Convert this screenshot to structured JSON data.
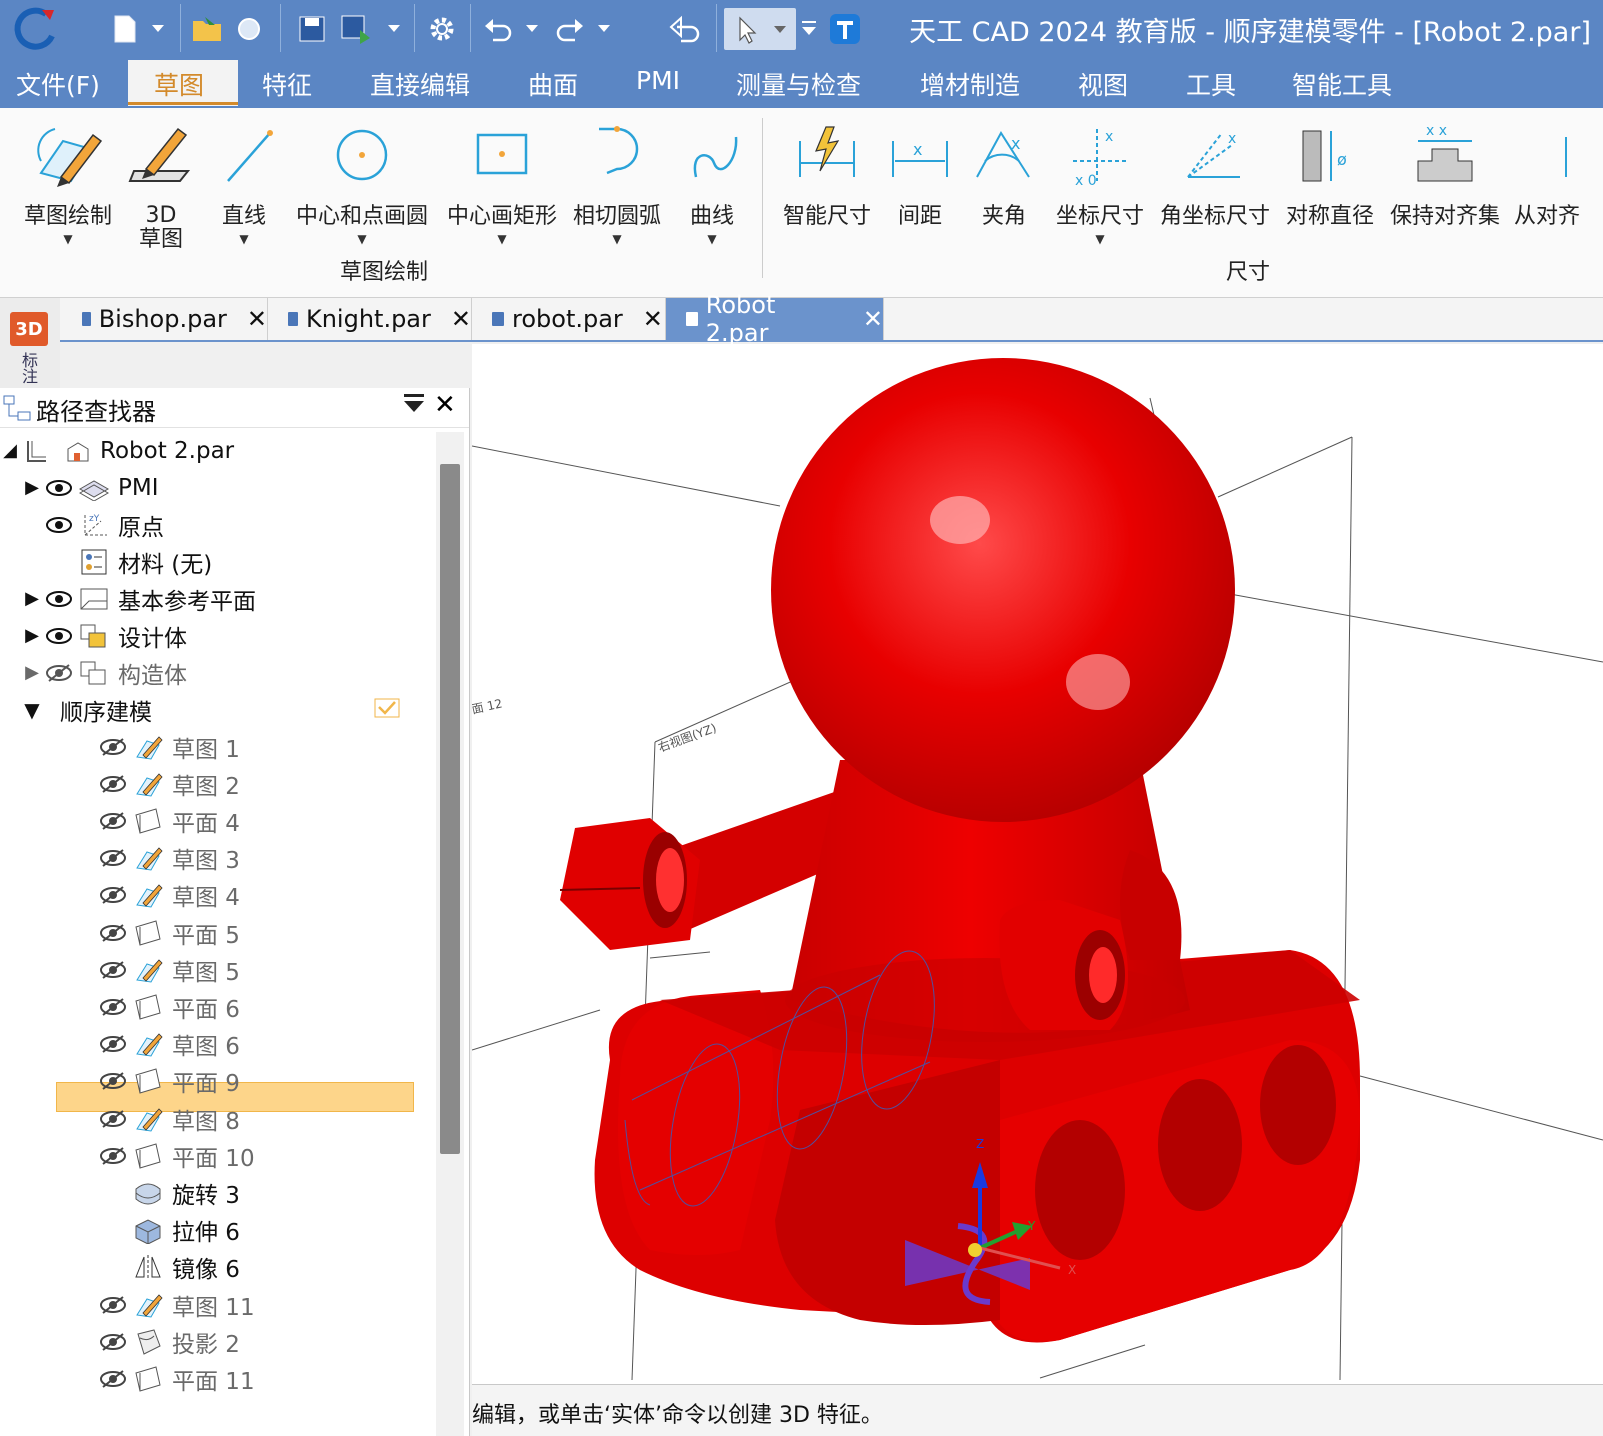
{
  "window": {
    "title": "天工 CAD 2024 教育版 - 顺序建模零件 - [Robot 2.par]"
  },
  "menu": {
    "items": [
      "文件(F)",
      "草图",
      "特征",
      "直接编辑",
      "曲面",
      "PMI",
      "测量与检查",
      "增材制造",
      "视图",
      "工具",
      "智能工具"
    ],
    "active": "草图"
  },
  "ribbon": {
    "sketch_group": {
      "label": "草图绘制",
      "buttons": [
        "草图绘制",
        "3D\n草图",
        "直线",
        "中心和点画圆",
        "中心画矩形",
        "相切圆弧",
        "曲线"
      ]
    },
    "dim_group": {
      "label": "尺寸",
      "buttons": [
        "智能尺寸",
        "间距",
        "夹角",
        "坐标尺寸",
        "角坐标尺寸",
        "对称直径",
        "保持对齐集",
        "从对齐"
      ]
    }
  },
  "side_strip": {
    "badge": "3D",
    "label": "标注"
  },
  "tabs": [
    {
      "label": "Bishop.par",
      "active": false
    },
    {
      "label": "Knight.par",
      "active": false
    },
    {
      "label": "robot.par",
      "active": false
    },
    {
      "label": "Robot 2.par",
      "active": true
    }
  ],
  "pathfinder": {
    "title": "路径查找器",
    "root": "Robot 2.par",
    "nodes": [
      {
        "label": "PMI"
      },
      {
        "label": "原点"
      },
      {
        "label": "材料 (无)"
      },
      {
        "label": "基本参考平面"
      },
      {
        "label": "设计体"
      },
      {
        "label": "构造体"
      },
      {
        "label": "顺序建模"
      }
    ],
    "features": [
      {
        "label": "草图 1",
        "icon": "sketch-icon",
        "hidden": true
      },
      {
        "label": "草图 2",
        "icon": "sketch-icon",
        "hidden": true
      },
      {
        "label": "平面 4",
        "icon": "plane-icon",
        "hidden": true
      },
      {
        "label": "草图 3",
        "icon": "sketch-icon",
        "hidden": true
      },
      {
        "label": "草图 4",
        "icon": "sketch-icon",
        "hidden": true
      },
      {
        "label": "平面 5",
        "icon": "plane-icon",
        "hidden": true
      },
      {
        "label": "草图 5",
        "icon": "sketch-icon",
        "hidden": true
      },
      {
        "label": "平面 6",
        "icon": "plane-icon",
        "hidden": true
      },
      {
        "label": "草图 6",
        "icon": "sketch-icon",
        "hidden": true
      },
      {
        "label": "平面 9",
        "icon": "plane-icon",
        "hidden": true
      },
      {
        "label": "草图 8",
        "icon": "sketch-icon",
        "hidden": true
      },
      {
        "label": "平面 10",
        "icon": "plane-icon",
        "hidden": true
      },
      {
        "label": "旋转 3",
        "icon": "revolve-icon",
        "hidden": false
      },
      {
        "label": "拉伸 6",
        "icon": "extrude-icon",
        "hidden": false
      },
      {
        "label": "镜像 6",
        "icon": "mirror-icon",
        "hidden": false
      },
      {
        "label": "草图 11",
        "icon": "sketch-icon",
        "hidden": true
      },
      {
        "label": "投影 2",
        "icon": "projection-icon",
        "hidden": true
      },
      {
        "label": "平面 11",
        "icon": "plane-icon",
        "hidden": true
      }
    ]
  },
  "viewport": {
    "plane_labels": [
      "面 12",
      "右视图(YZ)"
    ],
    "axis_labels": {
      "x": "X",
      "y": "Y",
      "z": "Z"
    },
    "model_color": "#e00000"
  },
  "status": {
    "text": "编辑，或单击‘实体’命令以创建 3D 特征。"
  }
}
